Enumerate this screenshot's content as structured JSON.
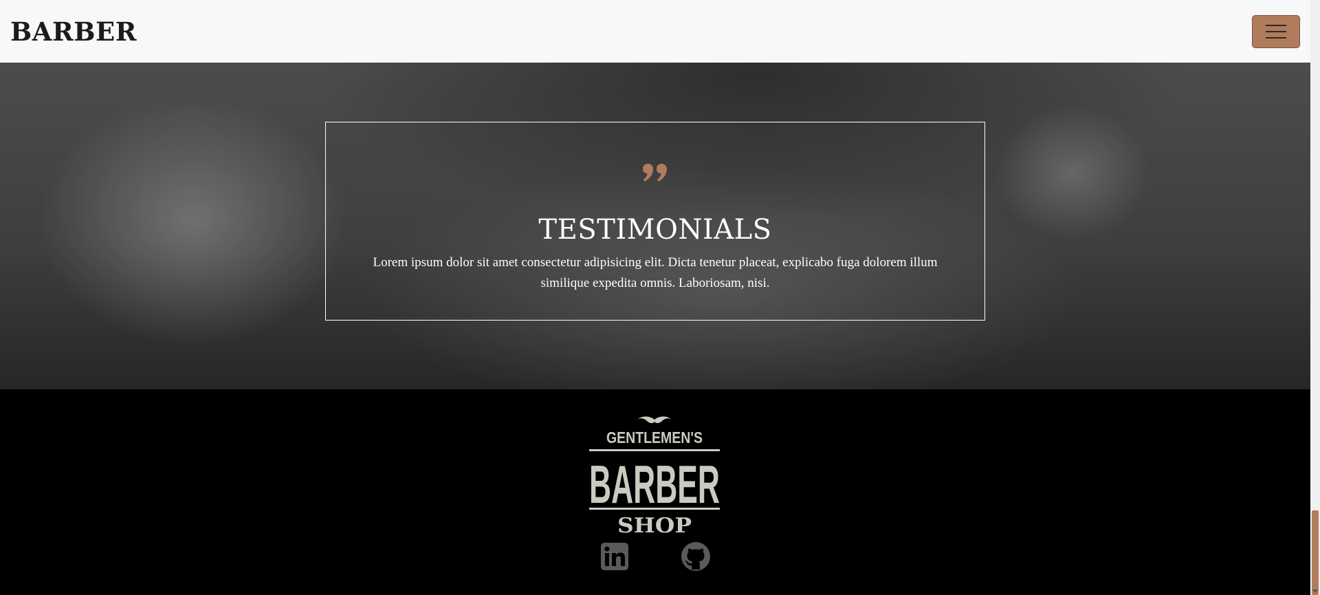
{
  "navbar": {
    "brand": "BARBER",
    "menu_icon": "hamburger-menu-icon"
  },
  "hero": {
    "quote_icon": "quote-icon",
    "title": "TESTIMONIALS",
    "text": "Lorem ipsum dolor sit amet consectetur adipisicing elit. Dicta tenetur placeat, explicabo fuga dolorem illum similique expedita omnis. Laboriosam, nisi."
  },
  "footer": {
    "logo": {
      "line1": "GENTLEMEN'S",
      "line2": "BARBER",
      "line3": "SHOP",
      "icon": "mustache-icon"
    },
    "social": [
      {
        "name": "linkedin-icon"
      },
      {
        "name": "github-icon"
      }
    ]
  },
  "colors": {
    "accent": "#b07c5b",
    "navbar_bg": "#f7f8fa",
    "footer_bg": "#000000",
    "logo_color": "#c9cbc0",
    "social_icon": "#5a5a5a"
  }
}
